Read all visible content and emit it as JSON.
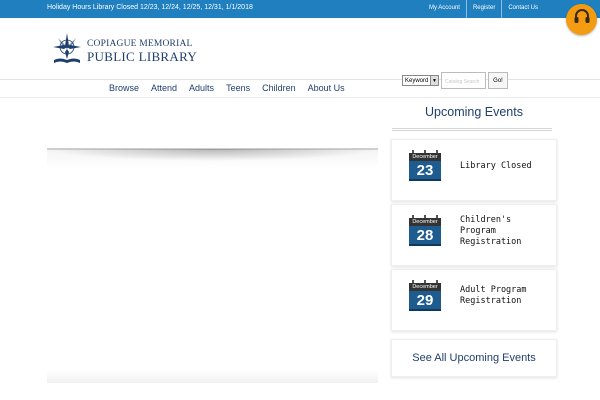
{
  "topbar": {
    "notice": "Holiday Hours Library Closed 12/23, 12/24, 12/25, 12/31, 1/1/2018",
    "links": [
      "My Account",
      "Register",
      "Contact Us"
    ]
  },
  "logo": {
    "line1": "COPIAGUE MEMORIAL",
    "line2": "PUBLIC LIBRARY"
  },
  "nav": [
    "Browse",
    "Attend",
    "Adults",
    "Teens",
    "Children",
    "About Us"
  ],
  "search": {
    "type_selected": "Keyword",
    "placeholder": "Catalog Search",
    "button": "Go!"
  },
  "events": {
    "title": "Upcoming Events",
    "items": [
      {
        "month": "December",
        "day": "23",
        "lines": [
          "Library Closed"
        ]
      },
      {
        "month": "December",
        "day": "28",
        "lines": [
          "Children's",
          "Program",
          "Registration"
        ]
      },
      {
        "month": "December",
        "day": "29",
        "lines": [
          "Adult Program",
          "Registration"
        ]
      }
    ],
    "see_all": "See All Upcoming Events"
  },
  "colors": {
    "topbar": "#1f7fbf",
    "brand_navy": "#1f3e6e",
    "calendar_blue": "#1e5c8f",
    "help_orange": "#f39c12"
  },
  "icons": {
    "help": "headset-icon",
    "logo": "compass-book-icon"
  }
}
